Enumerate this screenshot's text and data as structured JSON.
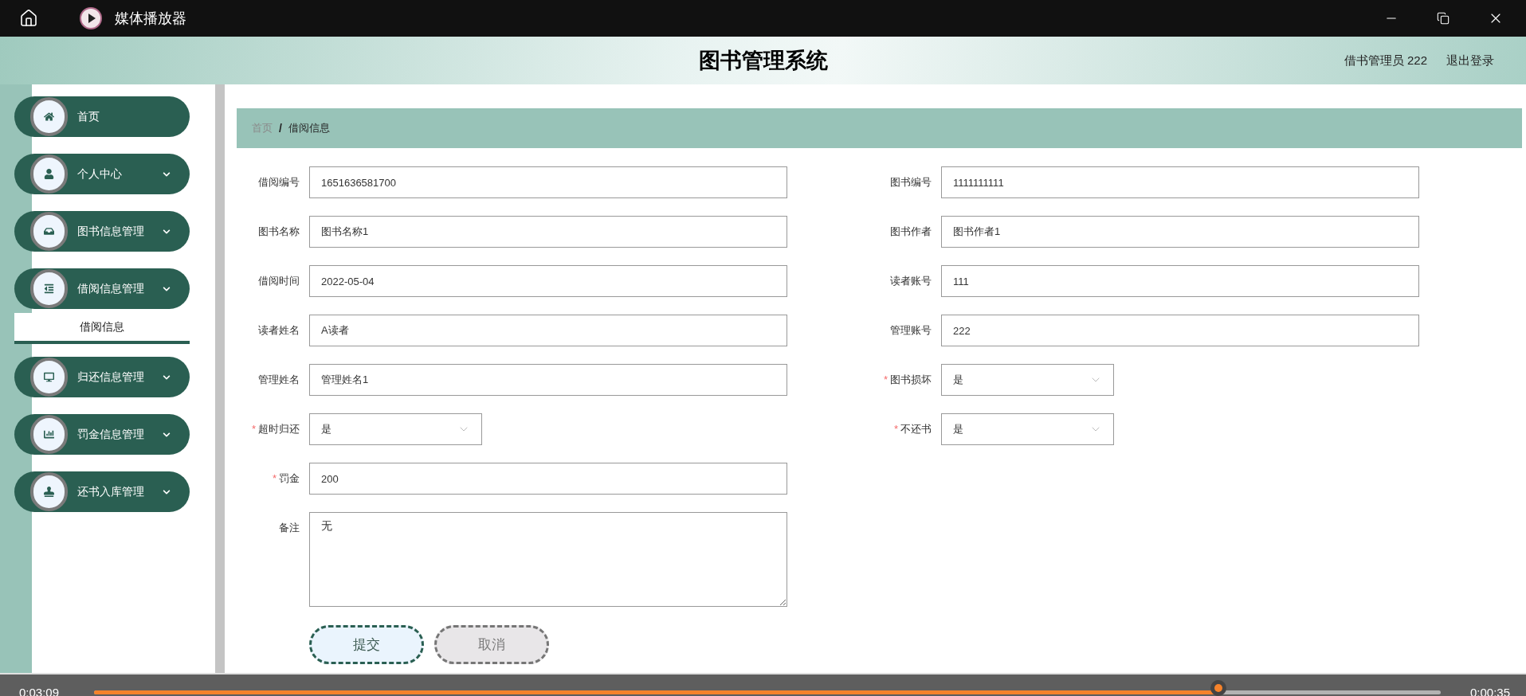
{
  "window": {
    "title": "媒体播放器"
  },
  "header": {
    "title": "图书管理系统",
    "user": "借书管理员 222",
    "logout": "退出登录"
  },
  "sidebar": {
    "items": [
      {
        "label": "首页",
        "submenu": false
      },
      {
        "label": "个人中心",
        "submenu": true,
        "expanded": false
      },
      {
        "label": "图书信息管理",
        "submenu": true,
        "expanded": false
      },
      {
        "label": "借阅信息管理",
        "submenu": true,
        "expanded": true,
        "children": [
          {
            "label": "借阅信息",
            "selected": true
          }
        ]
      },
      {
        "label": "归还信息管理",
        "submenu": true,
        "expanded": false
      },
      {
        "label": "罚金信息管理",
        "submenu": true,
        "expanded": false
      },
      {
        "label": "还书入库管理",
        "submenu": true,
        "expanded": false
      }
    ]
  },
  "breadcrumb": {
    "separator": "/",
    "items": [
      {
        "label": "首页",
        "current": false
      },
      {
        "label": "借阅信息",
        "current": true
      }
    ]
  },
  "form": {
    "left": [
      {
        "kind": "text",
        "label": "借阅编号",
        "value": "1651636581700"
      },
      {
        "kind": "text",
        "label": "图书名称",
        "value": "图书名称1"
      },
      {
        "kind": "text",
        "label": "借阅时间",
        "value": "2022-05-04"
      },
      {
        "kind": "text",
        "label": "读者姓名",
        "value": "A读者"
      },
      {
        "kind": "text",
        "label": "管理姓名",
        "value": "管理姓名1"
      },
      {
        "kind": "select",
        "label": "超时归还",
        "value": "是",
        "required_mark": "*"
      },
      {
        "kind": "text",
        "label": "罚金",
        "value": "200",
        "required_mark": "*"
      },
      {
        "kind": "textarea",
        "label": "备注",
        "value": "无"
      }
    ],
    "right": [
      {
        "kind": "text",
        "label": "图书编号",
        "value": "1111111111"
      },
      {
        "kind": "text",
        "label": "图书作者",
        "value": "图书作者1"
      },
      {
        "kind": "text",
        "label": "读者账号",
        "value": "111"
      },
      {
        "kind": "text",
        "label": "管理账号",
        "value": "222"
      },
      {
        "kind": "select",
        "label": "图书损坏",
        "value": "是",
        "required_mark": "*"
      },
      {
        "kind": "select",
        "label": "不还书",
        "value": "是",
        "required_mark": "*"
      }
    ],
    "buttons": [
      {
        "kind": "submit",
        "label": "提交"
      },
      {
        "kind": "cancel",
        "label": "取消"
      }
    ]
  },
  "player": {
    "elapsed": "0:03:09",
    "remaining": "0:00:35",
    "progress": {
      "level": 0.835
    }
  }
}
